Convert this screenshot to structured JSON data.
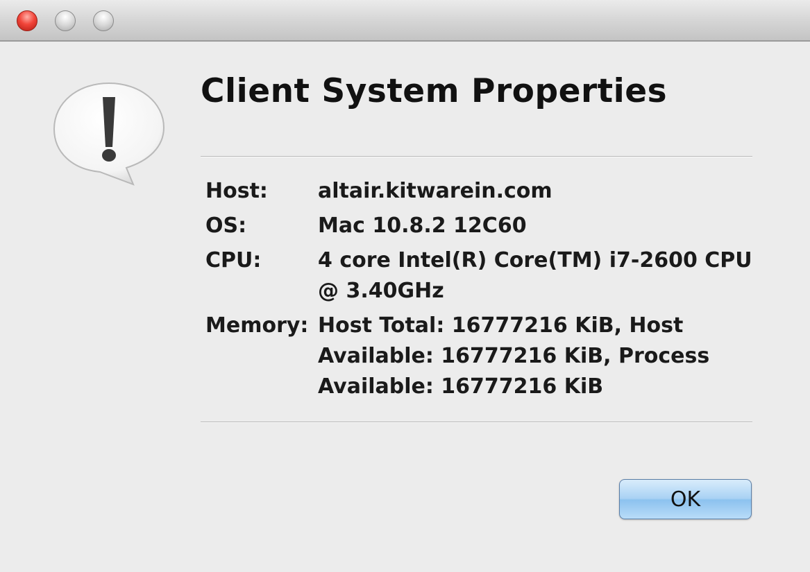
{
  "dialog": {
    "title": "Client System Properties",
    "icon": "alert-exclamation-icon",
    "ok_label": "OK"
  },
  "properties": [
    {
      "label": "Host:",
      "value": "altair.kitwarein.com"
    },
    {
      "label": "OS:",
      "value": "Mac 10.8.2 12C60"
    },
    {
      "label": "CPU:",
      "value": "4 core Intel(R) Core(TM) i7-2600 CPU @ 3.40GHz"
    },
    {
      "label": "Memory:",
      "value": "Host Total: 16777216 KiB, Host Available: 16777216 KiB, Process Available: 16777216 KiB"
    }
  ],
  "window_buttons": [
    "close",
    "minimize",
    "zoom"
  ],
  "colors": {
    "close_button": "#f2453a",
    "ok_button": "#a9d2f4",
    "background": "#ececec"
  }
}
